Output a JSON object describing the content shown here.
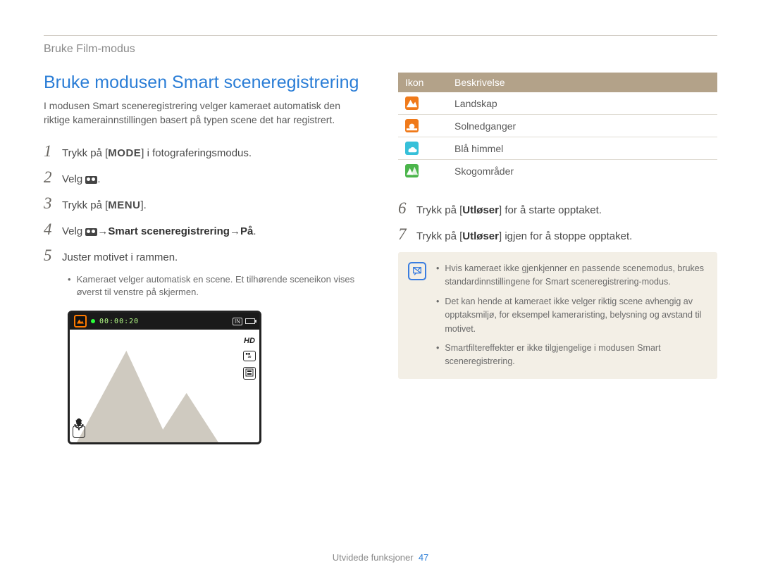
{
  "breadcrumb": "Bruke Film-modus",
  "title": "Bruke modusen Smart sceneregistrering",
  "intro": "I modusen Smart sceneregistrering velger kameraet automatisk den riktige kamerainnstillingen basert på typen scene det har registrert.",
  "steps": {
    "s1_a": "Trykk på [",
    "s1_mode": "MODE",
    "s1_b": "] i fotograferingsmodus.",
    "s2": "Velg ",
    "s2_end": ".",
    "s3_a": "Trykk på [",
    "s3_menu": "MENU",
    "s3_b": "].",
    "s4_a": "Velg ",
    "s4_arrow1": " → ",
    "s4_b": "Smart sceneregistrering",
    "s4_arrow2": " → ",
    "s4_c": "På",
    "s4_end": ".",
    "s5": "Juster motivet i rammen.",
    "s5_sub": "Kameraet velger automatisk en scene. Et tilhørende sceneikon vises øverst til venstre på skjermen.",
    "s6_a": "Trykk på [",
    "s6_b": "Utløser",
    "s6_c": "] for å starte opptaket.",
    "s7_a": "Trykk på [",
    "s7_b": "Utløser",
    "s7_c": "] igjen for å stoppe opptaket."
  },
  "preview": {
    "timer": "00:00:20",
    "hd": "HD",
    "fps": "30"
  },
  "table": {
    "head_icon": "Ikon",
    "head_desc": "Beskrivelse",
    "rows": [
      {
        "icon": "landscape",
        "color": "#f07a1a",
        "label": "Landskap"
      },
      {
        "icon": "sunset",
        "color": "#f07a1a",
        "label": "Solnedganger"
      },
      {
        "icon": "sky",
        "color": "#37c0d9",
        "label": "Blå himmel"
      },
      {
        "icon": "forest",
        "color": "#4bb54b",
        "label": "Skogområder"
      }
    ]
  },
  "notes": [
    "Hvis kameraet ikke gjenkjenner en passende scenemodus, brukes standardinnstillingene for Smart sceneregistrering-modus.",
    "Det kan hende at kameraet ikke velger riktig scene avhengig av opptaksmiljø, for eksempel kameraristing, belysning og avstand til motivet.",
    "Smartfiltereffekter er ikke tilgjengelige i modusen Smart sceneregistrering."
  ],
  "footer_label": "Utvidede funksjoner",
  "footer_page": "47"
}
